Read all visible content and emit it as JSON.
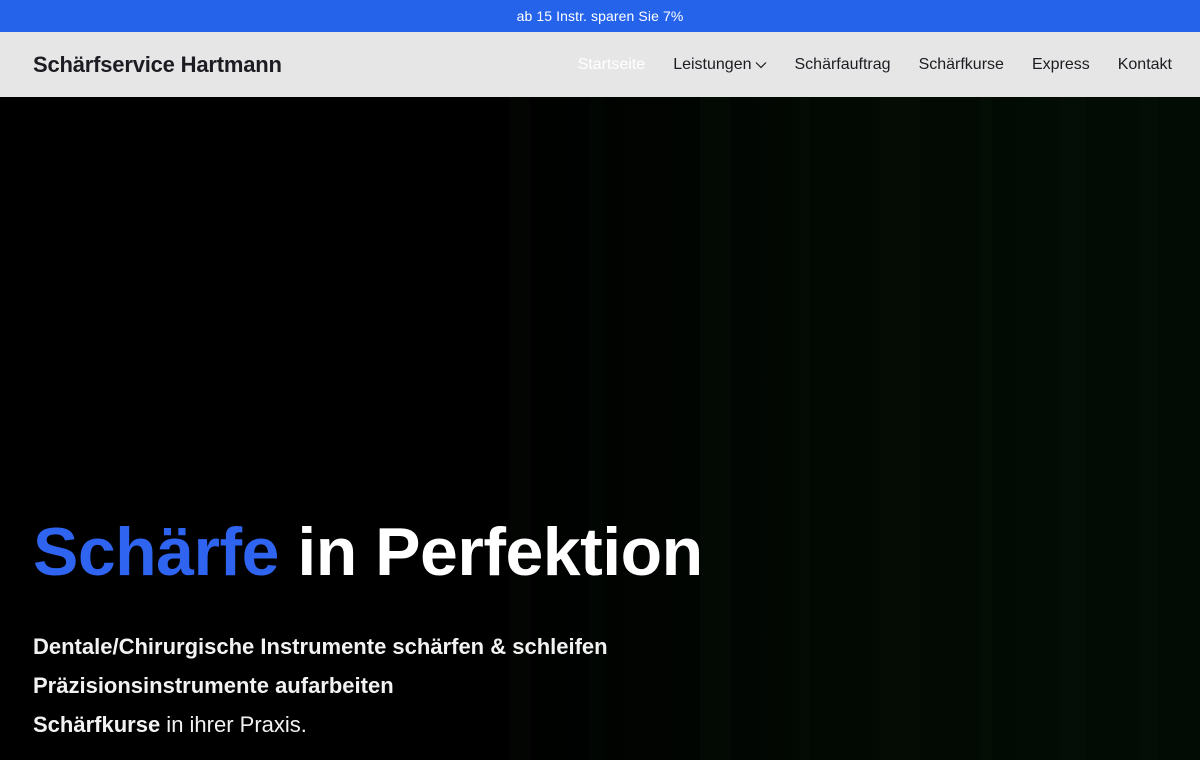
{
  "promo": {
    "text": "ab 15 Instr. sparen Sie 7%"
  },
  "nav": {
    "brand": "Schärfservice Hartmann",
    "links": [
      {
        "label": "Startseite"
      },
      {
        "label": "Leistungen"
      },
      {
        "label": "Schärfauftrag"
      },
      {
        "label": "Schärfkurse"
      },
      {
        "label": "Express"
      },
      {
        "label": "Kontakt"
      }
    ]
  },
  "hero": {
    "title_accent": "Schärfe",
    "title_rest": " in Perfektion",
    "line1": "Dentale/Chirurgische Instrumente schärfen & schleifen",
    "line2": "Präzisionsinstrumente aufarbeiten",
    "line3_bold": "Schärfkurse",
    "line3_rest": " in ihrer Praxis."
  },
  "colors": {
    "promo_bg": "#2563eb",
    "nav_bg": "#e6e6e6",
    "accent": "#2f64f0",
    "hero_bg": "#000000"
  }
}
